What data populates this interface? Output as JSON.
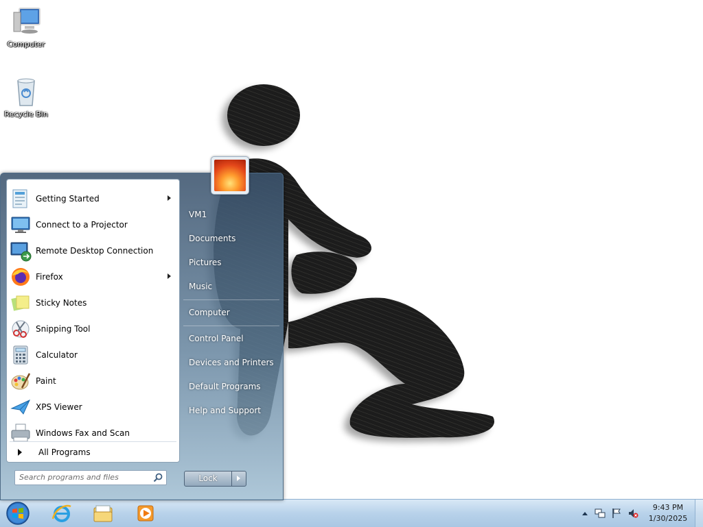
{
  "desktop": {
    "icons": [
      {
        "label": "Computer",
        "icon": "computer-icon"
      },
      {
        "label": "Recycle Bin",
        "icon": "recycle-bin-icon"
      }
    ]
  },
  "start_menu": {
    "programs": [
      {
        "label": "Getting Started",
        "icon": "getting-started-icon",
        "has_submenu": true
      },
      {
        "label": "Connect to a Projector",
        "icon": "projector-icon",
        "has_submenu": false
      },
      {
        "label": "Remote Desktop Connection",
        "icon": "remote-desktop-icon",
        "has_submenu": false
      },
      {
        "label": "Firefox",
        "icon": "firefox-icon",
        "has_submenu": true
      },
      {
        "label": "Sticky Notes",
        "icon": "sticky-notes-icon",
        "has_submenu": false
      },
      {
        "label": "Snipping Tool",
        "icon": "snipping-tool-icon",
        "has_submenu": false
      },
      {
        "label": "Calculator",
        "icon": "calculator-icon",
        "has_submenu": false
      },
      {
        "label": "Paint",
        "icon": "paint-icon",
        "has_submenu": false
      },
      {
        "label": "XPS Viewer",
        "icon": "xps-viewer-icon",
        "has_submenu": false
      },
      {
        "label": "Windows Fax and Scan",
        "icon": "fax-scan-icon",
        "has_submenu": false
      }
    ],
    "all_programs": "All Programs",
    "search_placeholder": "Search programs and files",
    "right_items": [
      {
        "label": "VM1"
      },
      {
        "label": "Documents"
      },
      {
        "label": "Pictures"
      },
      {
        "label": "Music"
      },
      {
        "label": "Computer"
      },
      {
        "label": "Control Panel"
      },
      {
        "label": "Devices and Printers"
      },
      {
        "label": "Default Programs"
      },
      {
        "label": "Help and Support"
      }
    ],
    "lock_label": "Lock"
  },
  "taskbar": {
    "pinned": [
      {
        "icon": "internet-explorer-icon"
      },
      {
        "icon": "file-explorer-icon"
      },
      {
        "icon": "media-player-icon"
      }
    ],
    "tray_icons": [
      "show-hidden-icons-icon",
      "network-icon",
      "action-center-flag-icon",
      "volume-muted-icon"
    ],
    "clock_time": "9:43 PM",
    "clock_date": "1/30/2025"
  },
  "colors": {
    "taskbar": "#b8d2ea",
    "start_menu_frame": "#5a7896",
    "wallpaper_figure": "#1f1f1f"
  }
}
